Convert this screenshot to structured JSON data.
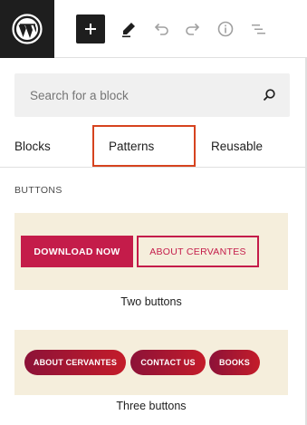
{
  "toolbar": {
    "logo_icon": "wordpress-icon",
    "add_icon": "plus-icon",
    "tools_icon": "pencil-icon",
    "undo_icon": "undo-icon",
    "redo_icon": "redo-icon",
    "info_icon": "info-icon",
    "outline_icon": "list-view-icon"
  },
  "inserter": {
    "search_placeholder": "Search for a block",
    "search_icon": "search-icon",
    "tabs": [
      {
        "label": "Blocks"
      },
      {
        "label": "Patterns"
      },
      {
        "label": "Reusable"
      }
    ],
    "active_tab": "Patterns",
    "highlight_color": "#d6431f",
    "section_title": "BUTTONS",
    "patterns": [
      {
        "caption": "Two buttons",
        "buttons": [
          "DOWNLOAD NOW",
          "ABOUT CERVANTES"
        ]
      },
      {
        "caption": "Three buttons",
        "buttons": [
          "ABOUT CERVANTES",
          "CONTACT US",
          "BOOKS"
        ]
      }
    ],
    "pattern_bg": "#f5eedc",
    "accent_color": "#c41c4a"
  }
}
